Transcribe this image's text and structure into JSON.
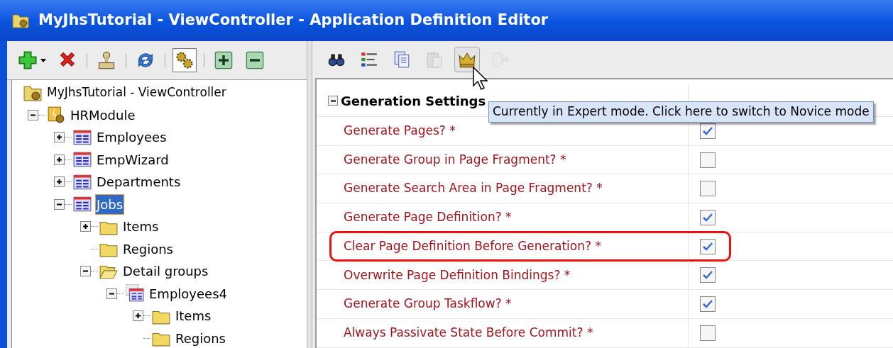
{
  "window": {
    "title": "MyJhsTutorial - ViewController - Application Definition Editor"
  },
  "left_toolbar": [
    {
      "kind": "add",
      "dropdown": true,
      "pressed": false
    },
    {
      "kind": "delete",
      "dropdown": false,
      "pressed": false
    },
    {
      "kind": "separator"
    },
    {
      "kind": "stamp",
      "dropdown": false,
      "pressed": false
    },
    {
      "kind": "separator"
    },
    {
      "kind": "refresh",
      "dropdown": false,
      "pressed": false
    },
    {
      "kind": "separator"
    },
    {
      "kind": "gears",
      "dropdown": false,
      "pressed": true
    },
    {
      "kind": "separator"
    },
    {
      "kind": "expand",
      "dropdown": false,
      "pressed": false
    },
    {
      "kind": "collapse",
      "dropdown": false,
      "pressed": false
    }
  ],
  "tree": [
    {
      "label": "MyJhsTutorial - ViewController",
      "kind": "app",
      "selected": false,
      "children": [
        {
          "label": "HRModule",
          "kind": "module",
          "expanded": true,
          "selected": false,
          "children": [
            {
              "label": "Employees",
              "kind": "view",
              "expanded": false,
              "selected": false
            },
            {
              "label": "EmpWizard",
              "kind": "view",
              "expanded": false,
              "selected": false
            },
            {
              "label": "Departments",
              "kind": "view",
              "expanded": false,
              "selected": false
            },
            {
              "label": "Jobs",
              "kind": "view",
              "expanded": true,
              "selected": true,
              "children": [
                {
                  "label": "Items",
                  "kind": "folder",
                  "expanded": false,
                  "selected": false
                },
                {
                  "label": "Regions",
                  "kind": "folder",
                  "selected": false
                },
                {
                  "label": "Detail groups",
                  "kind": "folder-open",
                  "expanded": true,
                  "selected": false,
                  "children": [
                    {
                      "label": "Employees4",
                      "kind": "detail-view",
                      "expanded": true,
                      "selected": false,
                      "children": [
                        {
                          "label": "Items",
                          "kind": "folder",
                          "expanded": false,
                          "selected": false
                        },
                        {
                          "label": "Regions",
                          "kind": "folder",
                          "selected": false
                        }
                      ]
                    }
                  ]
                }
              ]
            }
          ]
        }
      ]
    }
  ],
  "right_toolbar": [
    {
      "kind": "find",
      "pressed": false,
      "disabled": false
    },
    {
      "kind": "list",
      "pressed": false,
      "disabled": false
    },
    {
      "kind": "copy",
      "pressed": false,
      "disabled": false
    },
    {
      "kind": "paste",
      "pressed": false,
      "disabled": true
    },
    {
      "kind": "crown",
      "pressed": true,
      "disabled": false
    },
    {
      "kind": "export",
      "pressed": false,
      "disabled": true
    }
  ],
  "tooltip": "Currently in Expert mode. Click here to switch to Novice mode",
  "properties": {
    "section": {
      "title": "Generation Settings",
      "expanded": true
    },
    "rows": [
      {
        "label": "Generate Pages? *",
        "checked": true,
        "highlighted": false
      },
      {
        "label": "Generate Group in Page Fragment? *",
        "checked": false,
        "highlighted": false
      },
      {
        "label": "Generate Search Area in Page Fragment? *",
        "checked": false,
        "highlighted": false
      },
      {
        "label": "Generate Page Definition? *",
        "checked": true,
        "highlighted": false
      },
      {
        "label": "Clear Page Definition Before Generation? *",
        "checked": true,
        "highlighted": true
      },
      {
        "label": "Overwrite Page Definition Bindings? *",
        "checked": true,
        "highlighted": false
      },
      {
        "label": "Generate Group Taskflow? *",
        "checked": true,
        "highlighted": false
      },
      {
        "label": "Always Passivate State Before Commit? *",
        "checked": false,
        "highlighted": false
      }
    ]
  }
}
